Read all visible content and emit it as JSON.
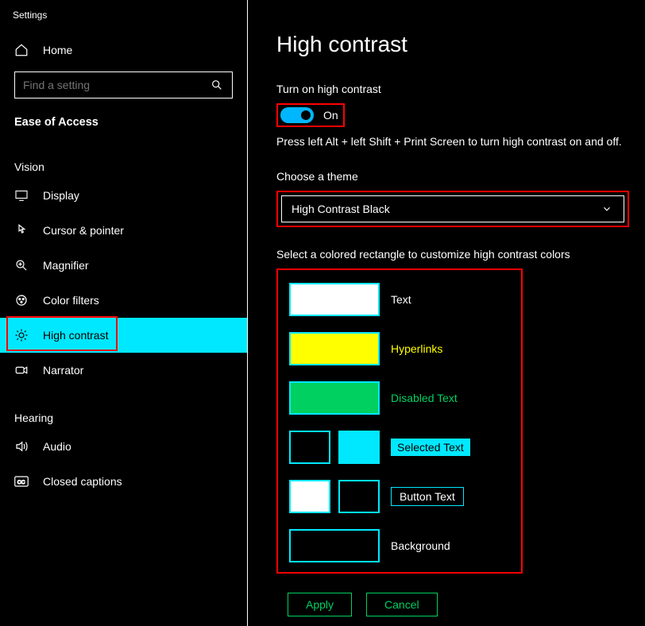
{
  "window_title": "Settings",
  "home_label": "Home",
  "search": {
    "placeholder": "Find a setting"
  },
  "section": "Ease of Access",
  "categories": {
    "vision": {
      "header": "Vision",
      "items": [
        {
          "label": "Display"
        },
        {
          "label": "Cursor & pointer"
        },
        {
          "label": "Magnifier"
        },
        {
          "label": "Color filters"
        },
        {
          "label": "High contrast"
        },
        {
          "label": "Narrator"
        }
      ]
    },
    "hearing": {
      "header": "Hearing",
      "items": [
        {
          "label": "Audio"
        },
        {
          "label": "Closed captions"
        }
      ]
    }
  },
  "main": {
    "title": "High contrast",
    "toggle_label": "Turn on high contrast",
    "toggle_state": "On",
    "hint": "Press left Alt + left Shift + Print Screen to turn high contrast on and off.",
    "theme_label": "Choose a theme",
    "theme_value": "High Contrast Black",
    "customize_label": "Select a colored rectangle to customize high contrast colors",
    "colors": {
      "text": {
        "label": "Text",
        "value": "#ffffff"
      },
      "hyperlinks": {
        "label": "Hyperlinks",
        "value": "#ffff00"
      },
      "disabled": {
        "label": "Disabled Text",
        "value": "#00d060"
      },
      "selected": {
        "label": "Selected Text",
        "fg": "#000000",
        "bg": "#00e8ff"
      },
      "button": {
        "label": "Button Text",
        "fg": "#ffffff",
        "bg": "#000000"
      },
      "background": {
        "label": "Background",
        "value": "#000000"
      }
    },
    "apply": "Apply",
    "cancel": "Cancel"
  }
}
